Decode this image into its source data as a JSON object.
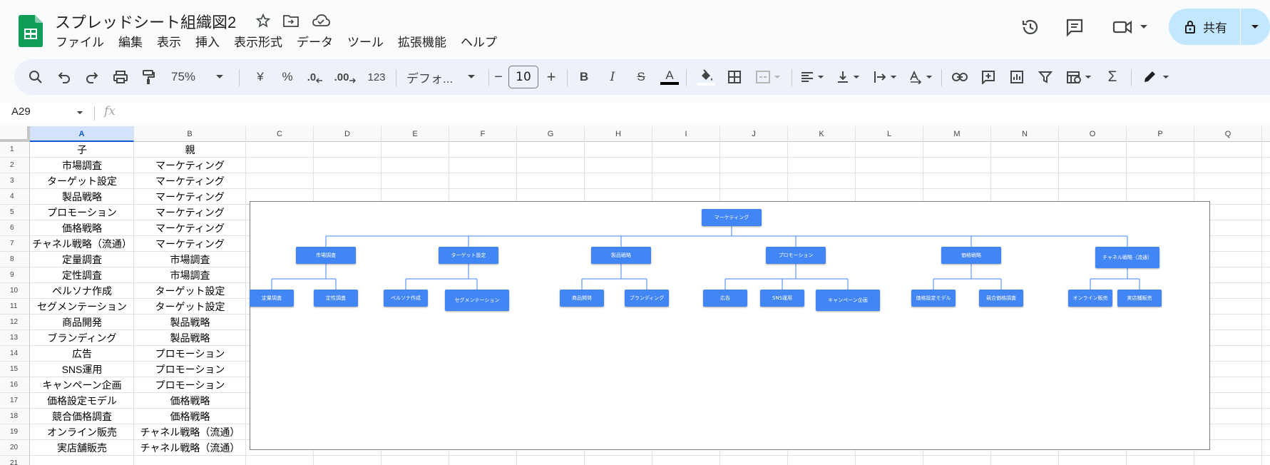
{
  "document": {
    "title": "スプレッドシート組織図2"
  },
  "menu": [
    "ファイル",
    "編集",
    "表示",
    "挿入",
    "表示形式",
    "データ",
    "ツール",
    "拡張機能",
    "ヘルプ"
  ],
  "share": {
    "label": "共有"
  },
  "toolbar": {
    "zoom": "75%",
    "currency": "¥",
    "percent": "%",
    "decimal_decrease": ".0",
    "decimal_increase": ".00",
    "number_format": "123",
    "font": "デフォ...",
    "font_size": "10",
    "minus": "−",
    "plus": "+",
    "bold": "B",
    "italic": "I",
    "strike": "S",
    "text_color": "A",
    "sum": "Σ"
  },
  "formula_bar": {
    "name_box": "A29",
    "fx": "fx"
  },
  "columns": [
    "A",
    "B",
    "C",
    "D",
    "E",
    "F",
    "G",
    "H",
    "I",
    "J",
    "K",
    "L",
    "M",
    "N",
    "O",
    "P",
    "Q"
  ],
  "selected_column": "A",
  "rows": [
    "1",
    "2",
    "3",
    "4",
    "5",
    "6",
    "7",
    "8",
    "9",
    "10",
    "11",
    "12",
    "13",
    "14",
    "15",
    "16",
    "17",
    "18",
    "19",
    "20",
    "21"
  ],
  "cells": [
    [
      "子",
      "親"
    ],
    [
      "市場調査",
      "マーケティング"
    ],
    [
      "ターゲット設定",
      "マーケティング"
    ],
    [
      "製品戦略",
      "マーケティング"
    ],
    [
      "プロモーション",
      "マーケティング"
    ],
    [
      "価格戦略",
      "マーケティング"
    ],
    [
      "チャネル戦略（流通）",
      "マーケティング"
    ],
    [
      "定量調査",
      "市場調査"
    ],
    [
      "定性調査",
      "市場調査"
    ],
    [
      "ペルソナ作成",
      "ターゲット設定"
    ],
    [
      "セグメンテーション",
      "ターゲット設定"
    ],
    [
      "商品開発",
      "製品戦略"
    ],
    [
      "ブランディング",
      "製品戦略"
    ],
    [
      "広告",
      "プロモーション"
    ],
    [
      "SNS運用",
      "プロモーション"
    ],
    [
      "キャンペーン企画",
      "プロモーション"
    ],
    [
      "価格設定モデル",
      "価格戦略"
    ],
    [
      "競合価格調査",
      "価格戦略"
    ],
    [
      "オンライン販売",
      "チャネル戦略（流通）"
    ],
    [
      "実店舗販売",
      "チャネル戦略（流通）"
    ]
  ],
  "org_chart": {
    "root": "マーケティング",
    "level1": [
      "市場調査",
      "ターゲット設定",
      "製品戦略",
      "プロモーション",
      "価格戦略",
      "チャネル戦略（流通）"
    ],
    "level2": [
      [
        "定量調査",
        "定性調査"
      ],
      [
        "ペルソナ作成",
        "セグメンテーション"
      ],
      [
        "商品開発",
        "ブランディング"
      ],
      [
        "広告",
        "SNS運用",
        "キャンペーン企画"
      ],
      [
        "価格設定モデル",
        "競合価格調査"
      ],
      [
        "オンライン販売",
        "実店舗販売"
      ]
    ],
    "node_color": "#4285f4"
  }
}
